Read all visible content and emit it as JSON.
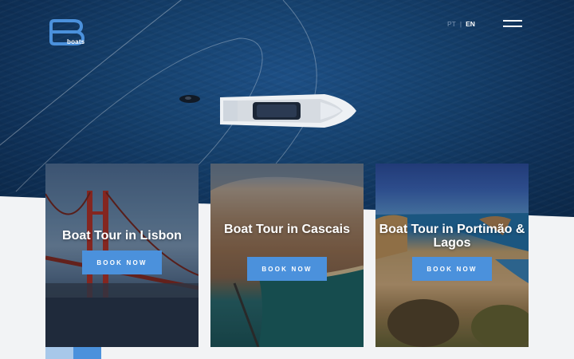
{
  "brand": {
    "name": "boats",
    "logo_letter": "B"
  },
  "header": {
    "languages": [
      {
        "code": "PT",
        "active": false
      },
      {
        "code": "EN",
        "active": true
      }
    ],
    "menu_icon": "hamburger-icon"
  },
  "tours": [
    {
      "title": "Boat Tour in Lisbon",
      "button": "BOOK NOW"
    },
    {
      "title": "Boat Tour in Cascais",
      "button": "BOOK NOW"
    },
    {
      "title": "Boat Tour in Portimão & Lagos",
      "button": "BOOK NOW"
    }
  ],
  "colors": {
    "accent": "#4b91dc",
    "accent_light": "#a8c8ea",
    "hero_sea": "#16426f",
    "background": "#f2f3f5"
  }
}
